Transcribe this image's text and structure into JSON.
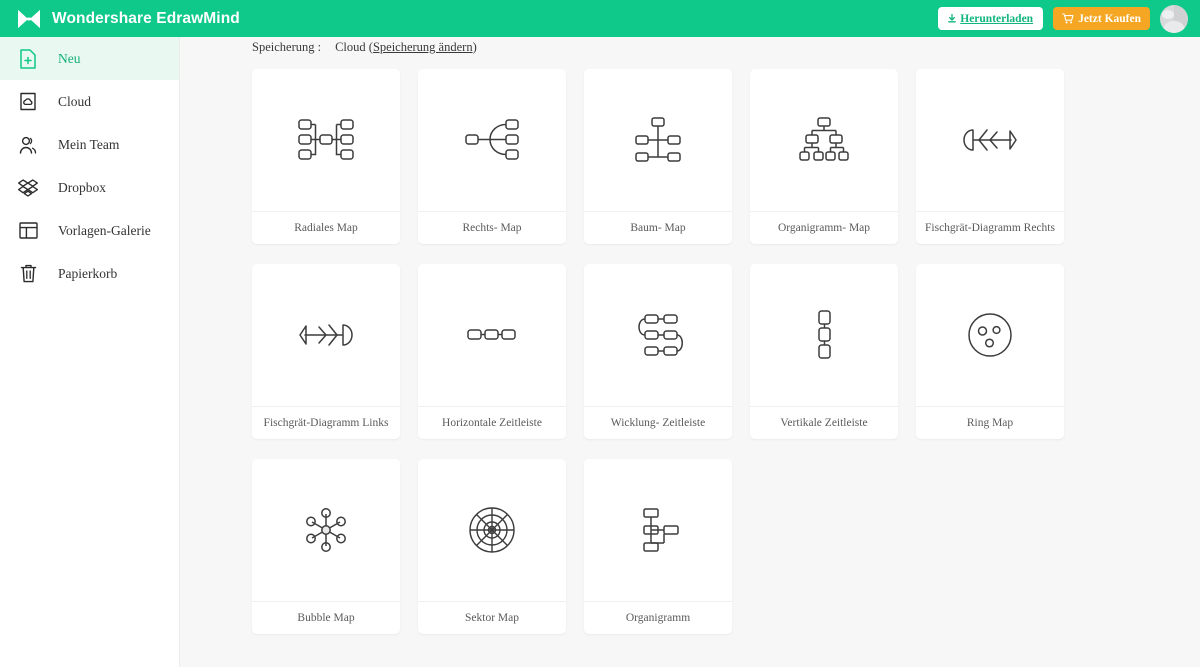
{
  "topbar": {
    "brand_name": "Wondershare EdrawMind",
    "logo_icon": "bowtie-logo-icon",
    "download_button": {
      "label": "Herunterladen",
      "icon": "download-icon"
    },
    "buy_button": {
      "label": "Jetzt Kaufen",
      "icon": "shopping-cart-icon"
    },
    "avatar": {
      "icon": "user-avatar"
    },
    "background_color": "#0fc98a",
    "buy_color": "#f5a623"
  },
  "sidebar": {
    "items": [
      {
        "label": "Neu",
        "icon": "new-document-icon",
        "active": true
      },
      {
        "label": "Cloud",
        "icon": "cloud-document-icon",
        "active": false
      },
      {
        "label": "Mein Team",
        "icon": "team-icon",
        "active": false
      },
      {
        "label": "Dropbox",
        "icon": "dropbox-icon",
        "active": false
      },
      {
        "label": "Vorlagen-Galerie",
        "icon": "template-gallery-icon",
        "active": false
      },
      {
        "label": "Papierkorb",
        "icon": "trash-icon",
        "active": false
      }
    ],
    "active_color": "#12b07b",
    "active_background": "#e9f9f2"
  },
  "main": {
    "storage": {
      "label": "Speicherung :",
      "value": "Cloud (",
      "change_link": "Speicherung ändern",
      "suffix": ")"
    },
    "templates": [
      {
        "label": "Radiales Map",
        "icon": "radial-map-icon"
      },
      {
        "label": "Rechts- Map",
        "icon": "right-map-icon"
      },
      {
        "label": "Baum- Map",
        "icon": "tree-map-icon"
      },
      {
        "label": "Organigramm- Map",
        "icon": "org-chart-map-icon"
      },
      {
        "label": "Fischgrät-Diagramm Rechts",
        "icon": "fishbone-right-icon"
      },
      {
        "label": "Fischgrät-Diagramm Links",
        "icon": "fishbone-left-icon"
      },
      {
        "label": "Horizontale Zeitleiste",
        "icon": "horizontal-timeline-icon"
      },
      {
        "label": "Wicklung- Zeitleiste",
        "icon": "winding-timeline-icon"
      },
      {
        "label": "Vertikale Zeitleiste",
        "icon": "vertical-timeline-icon"
      },
      {
        "label": "Ring Map",
        "icon": "ring-map-icon"
      },
      {
        "label": "Bubble Map",
        "icon": "bubble-map-icon"
      },
      {
        "label": "Sektor Map",
        "icon": "sector-map-icon"
      },
      {
        "label": "Organigramm",
        "icon": "org-chart-icon"
      }
    ]
  }
}
